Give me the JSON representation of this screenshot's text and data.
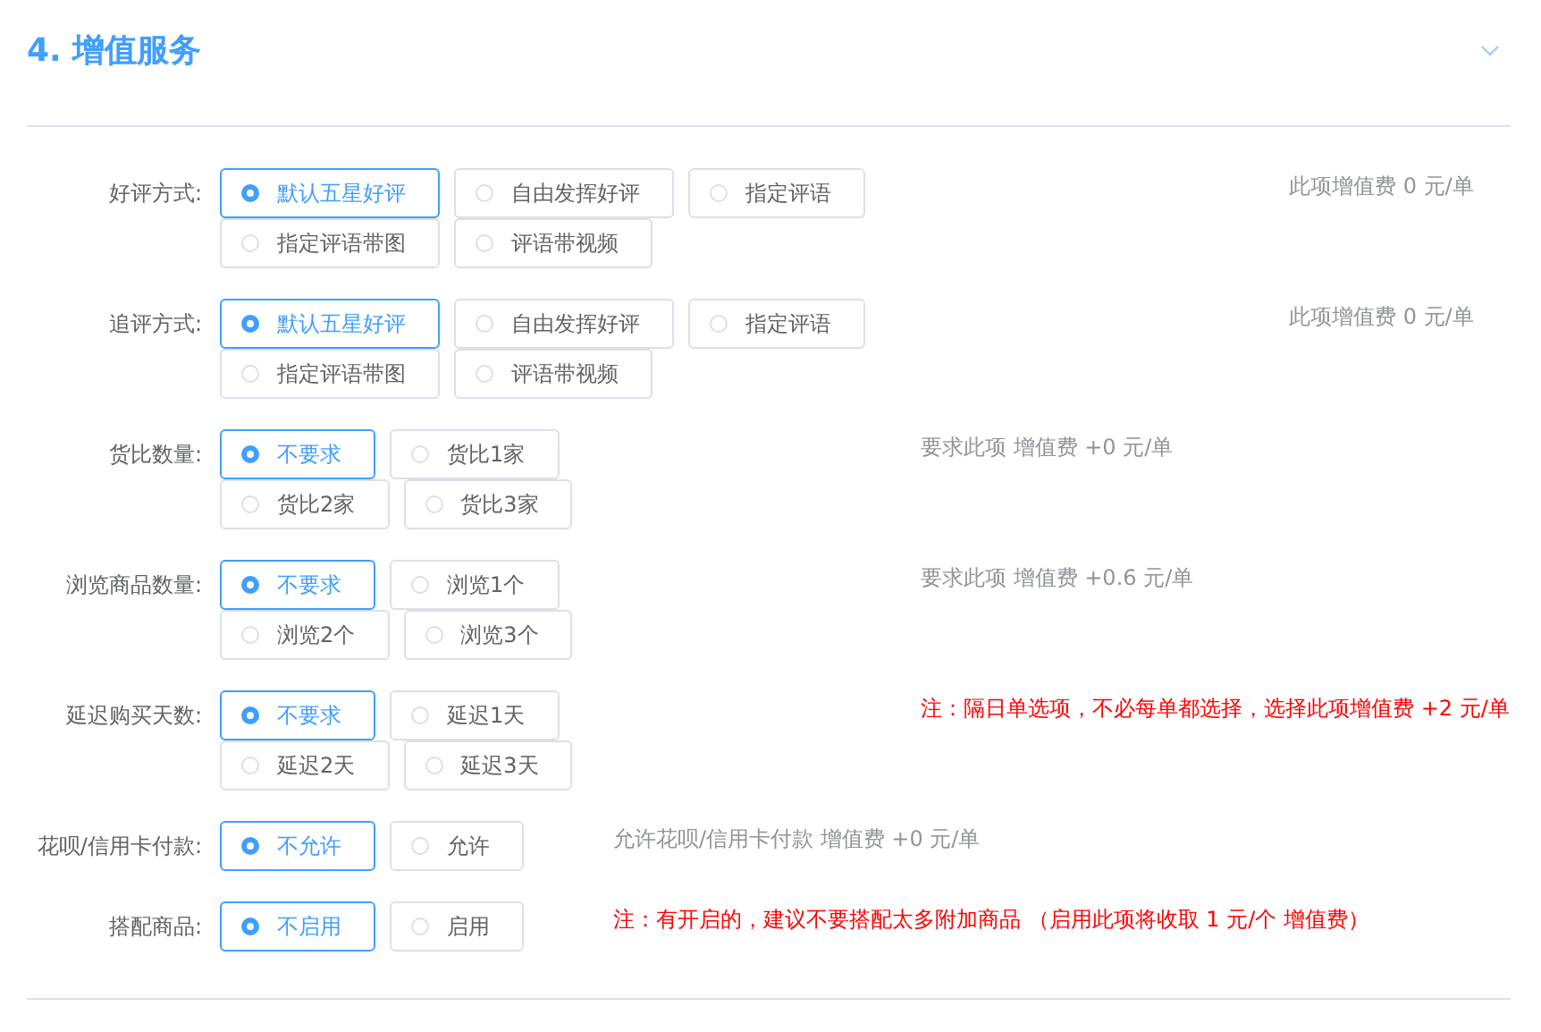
{
  "section": {
    "title": "4. 增值服务",
    "expanded": true
  },
  "rows": [
    {
      "label": "好评方式:",
      "options": [
        {
          "label": "默认五星好评",
          "selected": true
        },
        {
          "label": "自由发挥好评",
          "selected": false
        },
        {
          "label": "指定评语",
          "selected": false
        },
        {
          "label": "指定评语带图",
          "selected": false
        },
        {
          "label": "评语带视频",
          "selected": false
        }
      ],
      "note": {
        "text": "此项增值费 0 元/单",
        "kind": "info"
      }
    },
    {
      "label": "追评方式:",
      "options": [
        {
          "label": "默认五星好评",
          "selected": true
        },
        {
          "label": "自由发挥好评",
          "selected": false
        },
        {
          "label": "指定评语",
          "selected": false
        },
        {
          "label": "指定评语带图",
          "selected": false
        },
        {
          "label": "评语带视频",
          "selected": false
        }
      ],
      "note": {
        "text": "此项增值费 0 元/单",
        "kind": "info"
      }
    },
    {
      "label": "货比数量:",
      "options": [
        {
          "label": "不要求",
          "selected": true
        },
        {
          "label": "货比1家",
          "selected": false
        },
        {
          "label": "货比2家",
          "selected": false
        },
        {
          "label": "货比3家",
          "selected": false
        }
      ],
      "note": {
        "text": "要求此项 增值费 +0 元/单",
        "kind": "info"
      }
    },
    {
      "label": "浏览商品数量:",
      "options": [
        {
          "label": "不要求",
          "selected": true
        },
        {
          "label": "浏览1个",
          "selected": false
        },
        {
          "label": "浏览2个",
          "selected": false
        },
        {
          "label": "浏览3个",
          "selected": false
        }
      ],
      "note": {
        "text": "要求此项 增值费 +0.6 元/单",
        "kind": "info"
      }
    },
    {
      "label": "延迟购买天数:",
      "options": [
        {
          "label": "不要求",
          "selected": true
        },
        {
          "label": "延迟1天",
          "selected": false
        },
        {
          "label": "延迟2天",
          "selected": false
        },
        {
          "label": "延迟3天",
          "selected": false
        }
      ],
      "note": {
        "text": "注：隔日单选项，不必每单都选择，选择此项增值费 +2 元/单",
        "kind": "warning"
      }
    },
    {
      "label": "花呗/信用卡付款:",
      "options": [
        {
          "label": "不允许",
          "selected": true
        },
        {
          "label": "允许",
          "selected": false
        }
      ],
      "note": {
        "text": "允许花呗/信用卡付款 增值费 +0 元/单",
        "kind": "info"
      }
    },
    {
      "label": "搭配商品:",
      "options": [
        {
          "label": "不启用",
          "selected": true
        },
        {
          "label": "启用",
          "selected": false
        }
      ],
      "note": {
        "text": "注：有开启的，建议不要搭配太多附加商品 （启用此项将收取 1 元/个 增值费）",
        "kind": "warning"
      }
    }
  ]
}
